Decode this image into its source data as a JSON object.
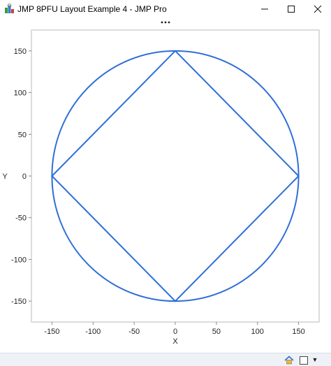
{
  "window": {
    "title": "JMP 8PFU Layout Example 4 - JMP Pro",
    "minimize_icon": "minimize-icon",
    "maximize_icon": "maximize-icon",
    "close_icon": "close-icon"
  },
  "toolbar": {
    "grip_icon": "more-options-icon"
  },
  "chart_data": {
    "type": "line",
    "xlabel": "X",
    "ylabel": "Y",
    "xlim": [
      -175,
      175
    ],
    "ylim": [
      -175,
      175
    ],
    "x_ticks": [
      -150,
      -100,
      -50,
      0,
      50,
      100,
      150
    ],
    "y_ticks": [
      -150,
      -100,
      -50,
      0,
      50,
      100,
      150
    ],
    "x_tick_labels": [
      "-150",
      "-100",
      "-50",
      "0",
      "50",
      "100",
      "150"
    ],
    "y_tick_labels": [
      "-150",
      "-100",
      "-50",
      "0",
      "50",
      "100",
      "150"
    ],
    "grid": false,
    "line_color": "#2e6fd8",
    "series": [
      {
        "shape": "circle",
        "center": [
          0,
          0
        ],
        "radius": 150
      },
      {
        "shape": "polygon",
        "points": [
          [
            0,
            150
          ],
          [
            150,
            0
          ],
          [
            0,
            -150
          ],
          [
            -150,
            0
          ],
          [
            0,
            150
          ]
        ]
      }
    ]
  },
  "statusbar": {
    "home_icon": "home-icon",
    "box_icon": "square-icon",
    "dropdown_glyph": "▼"
  }
}
